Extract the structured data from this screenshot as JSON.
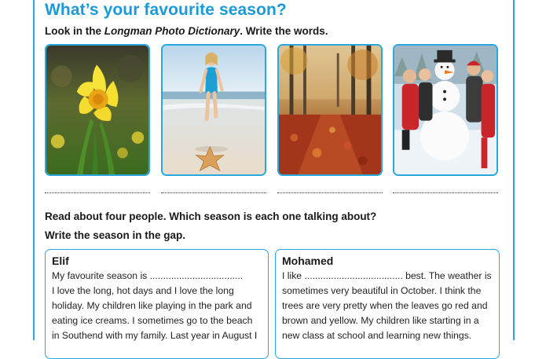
{
  "title": "What’s your favourite season?",
  "instruction1": {
    "pre": "Look in the ",
    "book": "Longman Photo Dictionary",
    "post": ". Write the words."
  },
  "photos": [
    {
      "subject": "daffodil-flower"
    },
    {
      "subject": "girl-on-beach-with-starfish"
    },
    {
      "subject": "autumn-leaves-path"
    },
    {
      "subject": "family-with-snowman"
    }
  ],
  "instruction2": "Read about four people. Which season is each one talking about?",
  "instruction3": "Write the season in the gap.",
  "cards": [
    {
      "name": "Elif",
      "lines": [
        "My favourite season is ...................................",
        "I love the long, hot days and I love the long",
        "holiday. My children like playing in the park and",
        "eating ice creams. I sometimes go to the beach",
        "in Southend with my family. Last year in August I"
      ]
    },
    {
      "name": "Mohamed",
      "lines": [
        "I like ..................................... best. The weather is",
        "sometimes very beautiful in October. I think the",
        "trees are very pretty when the leaves go red and",
        "brown and yellow. My children like starting in a",
        "new class at school and learning new things."
      ]
    }
  ],
  "colors": {
    "accent": "#1a9ad6",
    "border": "#2aa7dc"
  }
}
